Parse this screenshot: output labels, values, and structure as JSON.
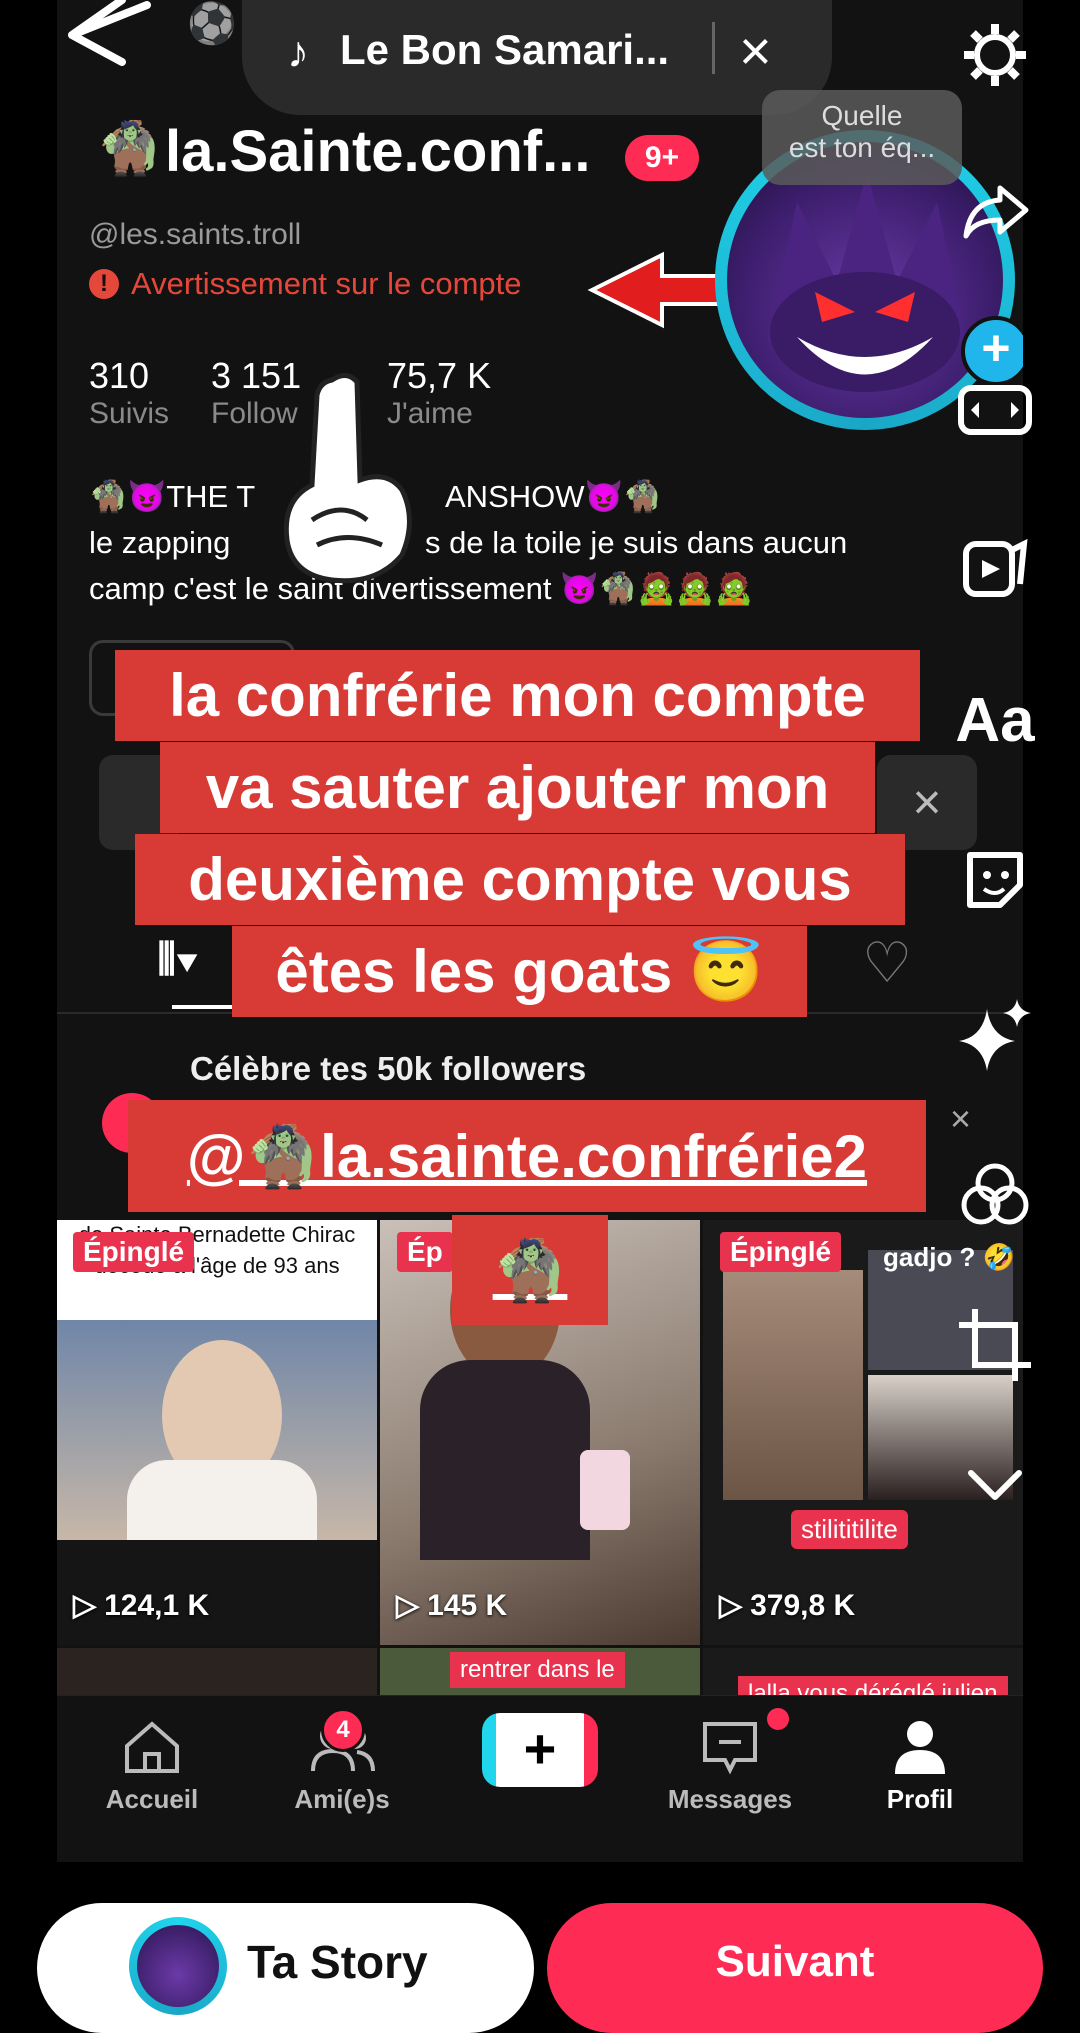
{
  "music": {
    "title": "Le Bon Samari...",
    "close": "×"
  },
  "profile": {
    "name": "la.Sainte.conf...",
    "emoji": "🧌",
    "notif_badge": "9+",
    "handle": "@les.saints.troll",
    "warning": "Avertissement sur le compte",
    "bubble_line1": "Quelle",
    "bubble_line2": "est ton éq...",
    "stats": [
      {
        "value": "310",
        "label": "Suivis"
      },
      {
        "value": "3 151",
        "label": "Follow"
      },
      {
        "value": "75,7 K",
        "label": "J'aime"
      }
    ],
    "bio_line1": "🧌😈THE T",
    "bio_line1_end": "ANSHOW😈🧌",
    "bio_line2_a": "le zapping",
    "bio_line2_b": "s de la toile je suis dans aucun",
    "bio_line3": "camp c'est le saint divertissement 😈🧌🧟🧟🧟"
  },
  "overlay": {
    "line1": "la confrérie mon compte",
    "line2": "va sauter ajouter mon",
    "line3": "deuxième compte vous",
    "line4": "êtes les goats 😇",
    "mention": "@🧌la.sainte.confrérie2",
    "sticker": "🧌",
    "close": "×"
  },
  "celebrate": {
    "text": "Célèbre tes 50k followers",
    "close": "×"
  },
  "videos": [
    {
      "pin": "Épinglé",
      "caption": "de Sainte Bernadette Chirac décédé à l'âge de 93 ans",
      "views": "124,1 K",
      "colors": [
        "#6f86a8",
        "#c7b7a8"
      ]
    },
    {
      "pin": "Ép",
      "caption": "",
      "views": "145 K",
      "colors": [
        "#b8a9a0",
        "#6d4a38"
      ]
    },
    {
      "pin": "Épinglé",
      "caption": "gadjo ? 🤣",
      "views": "379,8 K",
      "colors": [
        "#8d7b6e",
        "#3e3a38"
      ],
      "tag": "stilititilite"
    }
  ],
  "row2": {
    "mid_caption": "rentrer dans le",
    "right_caption": "lalla vous déréglé julien"
  },
  "nav": {
    "items": [
      "Accueil",
      "Ami(e)s",
      "Messages",
      "Profil"
    ],
    "friends_badge": "4",
    "plus": "+"
  },
  "bottom": {
    "story": "Ta Story",
    "next": "Suivant"
  },
  "colors": {
    "accent": "#fe2c55",
    "overlay_red": "#d83a35",
    "teal": "#20d5ec"
  }
}
